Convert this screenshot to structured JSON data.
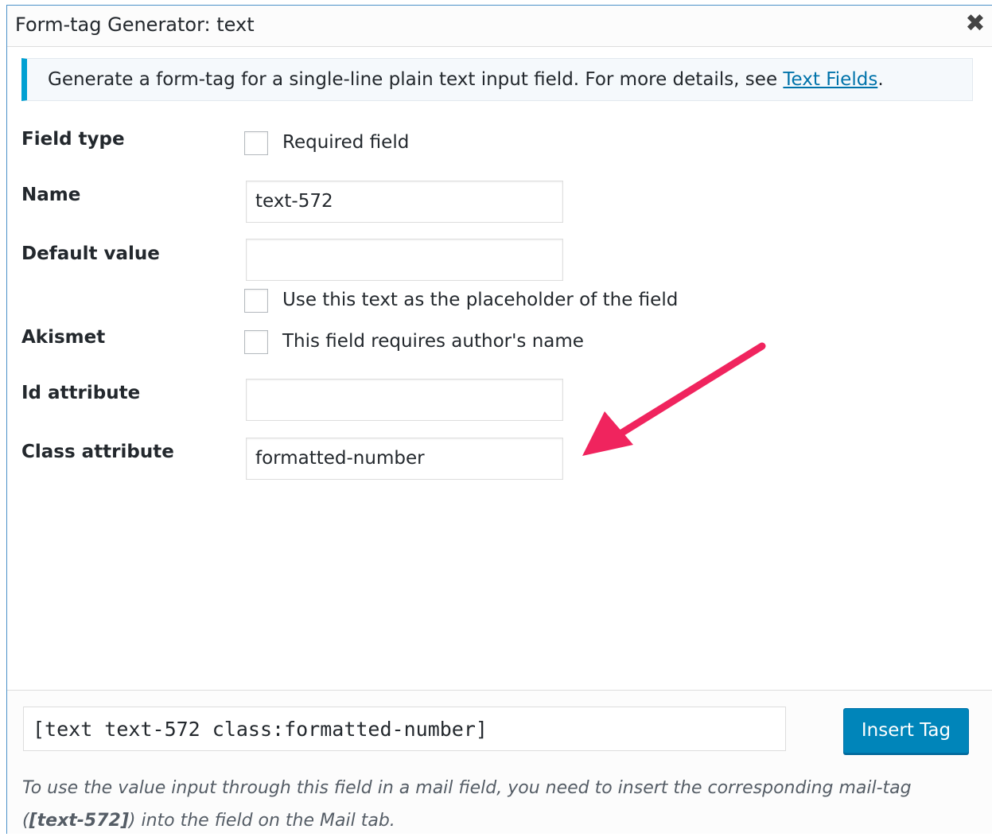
{
  "window": {
    "title": "Form-tag Generator: text",
    "close_glyph": "✖"
  },
  "notice": {
    "text": "Generate a form-tag for a single-line plain text input field. For more details, see ",
    "link": "Text Fields",
    "suffix": "."
  },
  "fields": {
    "field_type": {
      "label": "Field type",
      "checkbox_label": "Required field",
      "checked": false
    },
    "name": {
      "label": "Name",
      "value": "text-572"
    },
    "default_value": {
      "label": "Default value",
      "value": "",
      "checkbox_label": "Use this text as the placeholder of the field",
      "checked": false
    },
    "akismet": {
      "label": "Akismet",
      "checkbox_label": "This field requires author's name",
      "checked": false
    },
    "id_attribute": {
      "label": "Id attribute",
      "value": ""
    },
    "class_attribute": {
      "label": "Class attribute",
      "value": "formatted-number"
    }
  },
  "footer": {
    "tag": "[text text-572 class:formatted-number]",
    "insert_label": "Insert Tag",
    "hint_before": "To use the value input through this field in a mail field, you need to insert the corresponding mail-tag (",
    "hint_tag": "[text-572]",
    "hint_after": ") into the field on the Mail tab."
  },
  "colors": {
    "accent": "#00a0d2",
    "button": "#0085ba",
    "link": "#0073aa",
    "annotation_arrow": "#f0245e"
  }
}
